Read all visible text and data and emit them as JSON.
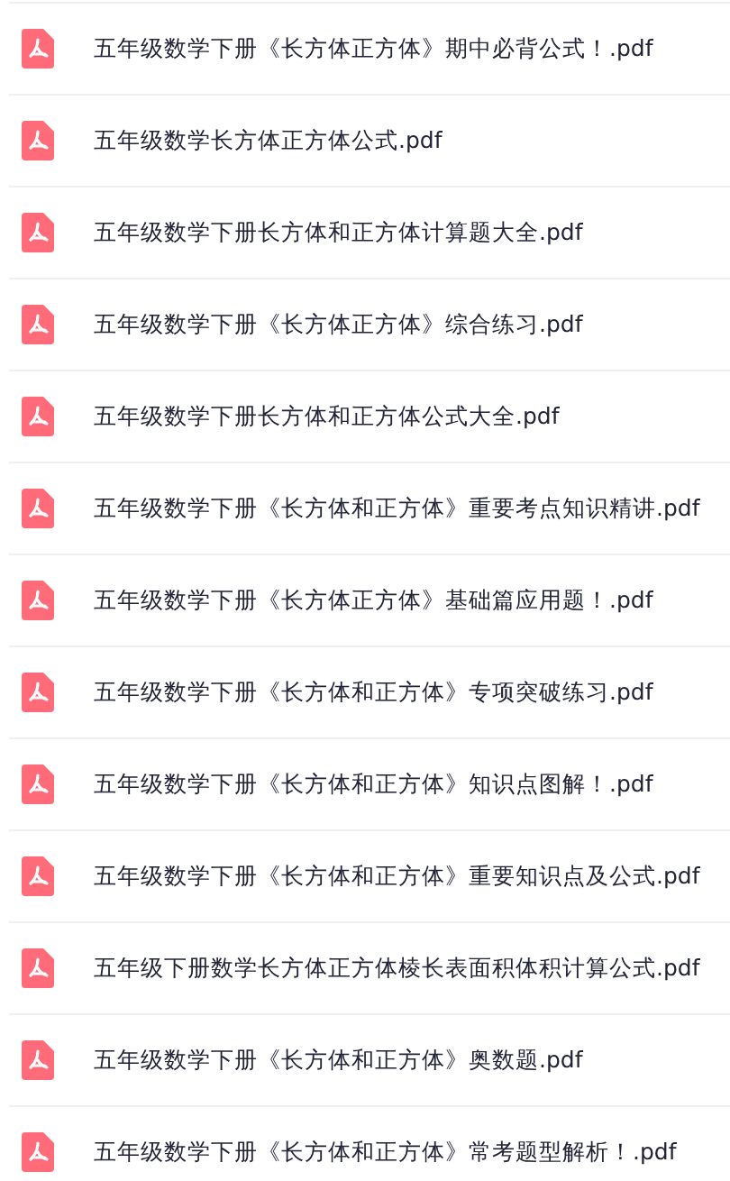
{
  "files": [
    {
      "name": "五年级数学下册《长方体正方体》期中必背公式！.pdf"
    },
    {
      "name": "五年级数学长方体正方体公式.pdf"
    },
    {
      "name": "五年级数学下册长方体和正方体计算题大全.pdf"
    },
    {
      "name": "五年级数学下册《长方体正方体》综合练习.pdf"
    },
    {
      "name": "五年级数学下册长方体和正方体公式大全.pdf"
    },
    {
      "name": "五年级数学下册《长方体和正方体》重要考点知识精讲.pdf"
    },
    {
      "name": "五年级数学下册《长方体正方体》基础篇应用题！.pdf"
    },
    {
      "name": "五年级数学下册《长方体和正方体》专项突破练习.pdf"
    },
    {
      "name": "五年级数学下册《长方体和正方体》知识点图解！.pdf"
    },
    {
      "name": "五年级数学下册《长方体和正方体》重要知识点及公式.pdf"
    },
    {
      "name": "五年级下册数学长方体正方体棱长表面积体积计算公式.pdf"
    },
    {
      "name": "五年级数学下册《长方体和正方体》奥数题.pdf"
    },
    {
      "name": "五年级数学下册《长方体和正方体》常考题型解析！.pdf"
    }
  ]
}
